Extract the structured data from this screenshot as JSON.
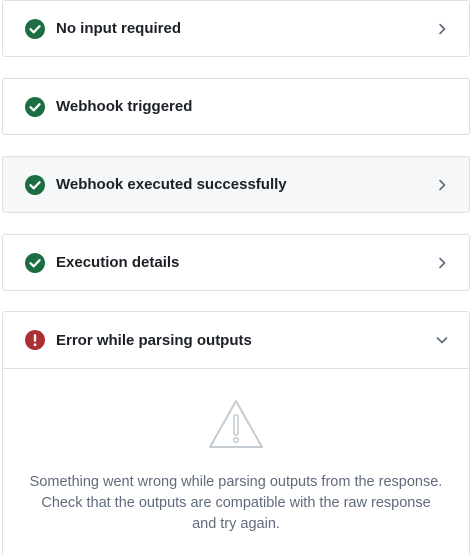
{
  "steps": [
    {
      "label": "No input required",
      "status": "success",
      "icon": "check-circle-icon",
      "chevron": "chevron-right-icon"
    },
    {
      "label": "Webhook triggered",
      "status": "success",
      "icon": "check-circle-icon",
      "chevron": null
    },
    {
      "label": "Webhook executed successfully",
      "status": "success",
      "icon": "check-circle-icon",
      "chevron": "chevron-right-icon"
    },
    {
      "label": "Execution details",
      "status": "success",
      "icon": "check-circle-icon",
      "chevron": "chevron-right-icon"
    }
  ],
  "error_panel": {
    "label": "Error while parsing outputs",
    "status": "error",
    "icon": "error-circle-icon",
    "chevron": "chevron-down-icon",
    "empty_state_icon": "warning-triangle-icon",
    "message_lines": [
      "Something went wrong while parsing outputs from the response.",
      "Check that the outputs are compatible with the raw response",
      "and try again."
    ]
  },
  "colors": {
    "success": "#1c6e42",
    "error": "#ac2f33",
    "muted_text": "#5f6b7c",
    "border": "#dcdfe4",
    "hover_bg": "#f5f7f9"
  }
}
